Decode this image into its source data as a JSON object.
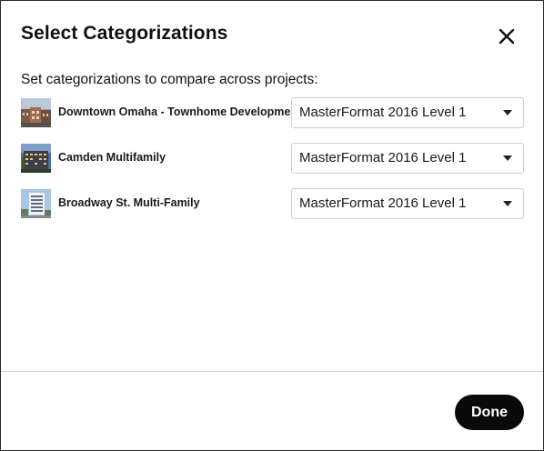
{
  "dialog": {
    "title": "Select Categorizations",
    "subtitle": "Set categorizations to compare across projects:",
    "close_icon": "close-icon",
    "done_label": "Done"
  },
  "projects": [
    {
      "name": "Downtown Omaha - Townhome Development",
      "categorization": "MasterFormat 2016 Level 1",
      "thumbnail_icon": "project-thumbnail"
    },
    {
      "name": "Camden Multifamily",
      "categorization": "MasterFormat 2016 Level 1",
      "thumbnail_icon": "project-thumbnail"
    },
    {
      "name": "Broadway St. Multi-Family",
      "categorization": "MasterFormat 2016 Level 1",
      "thumbnail_icon": "project-thumbnail"
    }
  ],
  "colors": {
    "button_bg": "#0a0a0a",
    "border": "#cfcfcf",
    "divider": "#d2d2d2"
  }
}
